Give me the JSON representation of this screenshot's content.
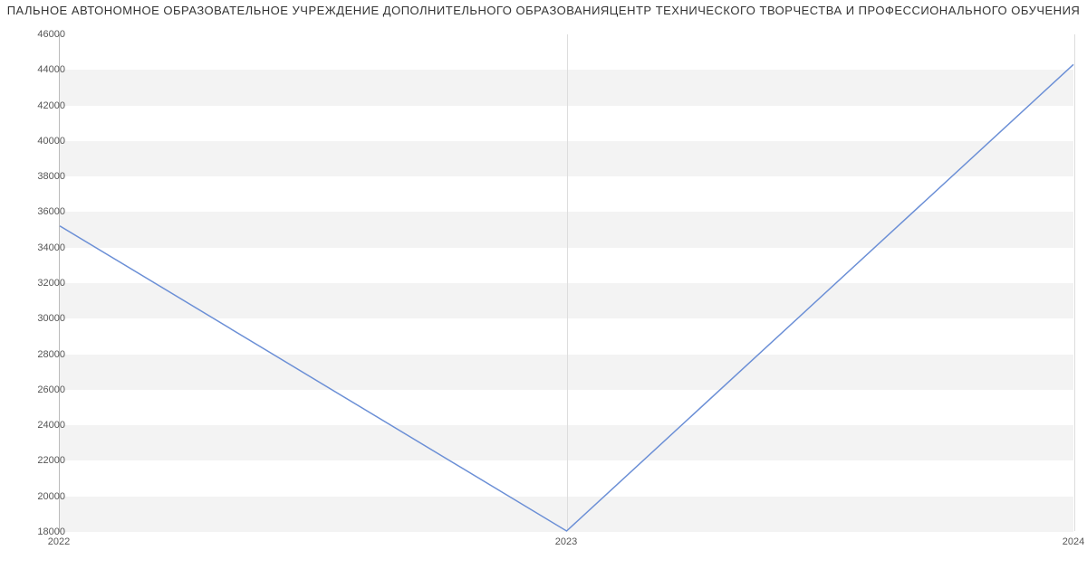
{
  "chart_data": {
    "type": "line",
    "title": "ПАЛЬНОЕ АВТОНОМНОЕ ОБРАЗОВАТЕЛЬНОЕ УЧРЕЖДЕНИЕ ДОПОЛНИТЕЛЬНОГО ОБРАЗОВАНИЯЦЕНТР ТЕХНИЧЕСКОГО ТВОРЧЕСТВА И ПРОФЕССИОНАЛЬНОГО ОБУЧЕНИЯ",
    "categories": [
      "2022",
      "2023",
      "2024"
    ],
    "values": [
      35200,
      18000,
      44300
    ],
    "xlabel": "",
    "ylabel": "",
    "ylim": [
      18000,
      46000
    ],
    "y_ticks": [
      18000,
      20000,
      22000,
      24000,
      26000,
      28000,
      30000,
      32000,
      34000,
      36000,
      38000,
      40000,
      42000,
      44000,
      46000
    ],
    "grid": true
  }
}
